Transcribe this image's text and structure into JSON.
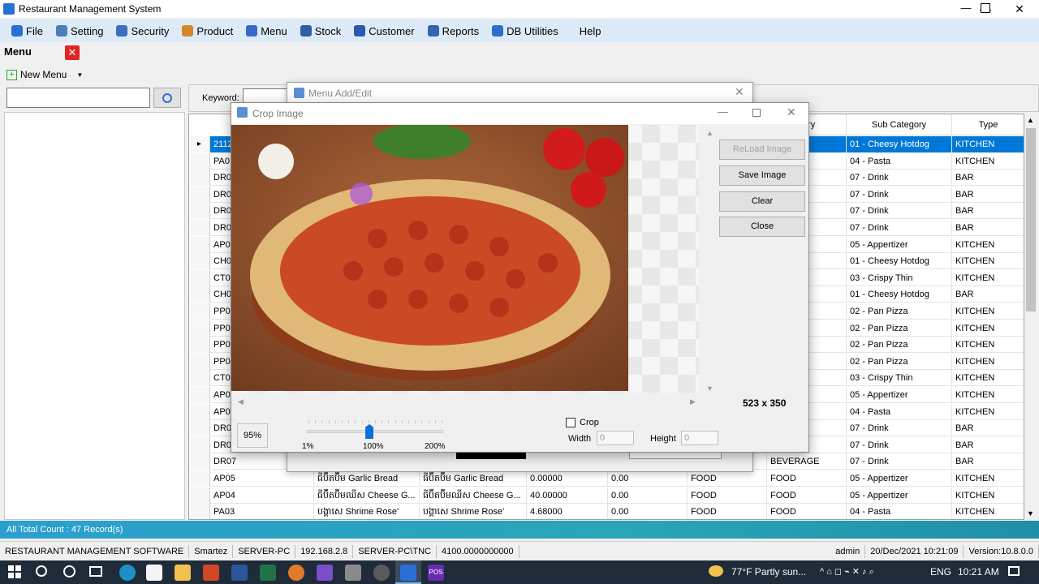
{
  "window": {
    "title": "Restaurant Management System"
  },
  "menubar": [
    {
      "label": "File",
      "color": "#2a6fd6"
    },
    {
      "label": "Setting",
      "color": "#4a7fb8"
    },
    {
      "label": "Security",
      "color": "#3c6fc0"
    },
    {
      "label": "Product",
      "color": "#d08a2a"
    },
    {
      "label": "Menu",
      "color": "#3a68c8"
    },
    {
      "label": "Stock",
      "color": "#2f5fa8"
    },
    {
      "label": "Customer",
      "color": "#2b58b0"
    },
    {
      "label": "Reports",
      "color": "#3266b5"
    },
    {
      "label": "DB Utilities",
      "color": "#2d6dcc"
    },
    {
      "label": "Help",
      "color": ""
    }
  ],
  "left": {
    "title": "Menu",
    "close_label": "✕",
    "new_menu_label": "New Menu"
  },
  "keyword_label": "Keyword:",
  "grid": {
    "headers": {
      "category": "ory",
      "subcategory": "Sub Category",
      "type": "Type"
    },
    "rows": [
      {
        "code": "2112",
        "name": "",
        "name2": "",
        "price": "",
        "disc": "",
        "group": "",
        "category": "",
        "sub": "01 - Cheesy Hotdog",
        "type": "KITCHEN",
        "selected": true
      },
      {
        "code": "PA0",
        "name": "",
        "name2": "",
        "price": "",
        "disc": "",
        "group": "",
        "category": "",
        "sub": "04 - Pasta",
        "type": "KITCHEN"
      },
      {
        "code": "DR0",
        "name": "",
        "name2": "",
        "price": "",
        "disc": "",
        "group": "",
        "category": "E",
        "sub": "07 - Drink",
        "type": "BAR"
      },
      {
        "code": "DR0",
        "name": "",
        "name2": "",
        "price": "",
        "disc": "",
        "group": "",
        "category": "E",
        "sub": "07 - Drink",
        "type": "BAR"
      },
      {
        "code": "DR0",
        "name": "",
        "name2": "",
        "price": "",
        "disc": "",
        "group": "",
        "category": "E",
        "sub": "07 - Drink",
        "type": "BAR"
      },
      {
        "code": "DR0",
        "name": "",
        "name2": "",
        "price": "",
        "disc": "",
        "group": "",
        "category": "E",
        "sub": "07 - Drink",
        "type": "BAR"
      },
      {
        "code": "AP0",
        "name": "",
        "name2": "",
        "price": "",
        "disc": "",
        "group": "",
        "category": "",
        "sub": "05 - Appertizer",
        "type": "KITCHEN"
      },
      {
        "code": "CH0",
        "name": "",
        "name2": "",
        "price": "",
        "disc": "",
        "group": "",
        "category": "",
        "sub": "01 - Cheesy Hotdog",
        "type": "KITCHEN"
      },
      {
        "code": "CT0",
        "name": "",
        "name2": "",
        "price": "",
        "disc": "",
        "group": "",
        "category": "",
        "sub": "03 - Crispy Thin",
        "type": "KITCHEN"
      },
      {
        "code": "CH0",
        "name": "",
        "name2": "",
        "price": "",
        "disc": "",
        "group": "",
        "category": "",
        "sub": "01 - Cheesy Hotdog",
        "type": "BAR"
      },
      {
        "code": "PP0",
        "name": "",
        "name2": "",
        "price": "",
        "disc": "",
        "group": "",
        "category": "",
        "sub": "02 - Pan Pizza",
        "type": "KITCHEN"
      },
      {
        "code": "PP0",
        "name": "",
        "name2": "",
        "price": "",
        "disc": "",
        "group": "",
        "category": "",
        "sub": "02 - Pan Pizza",
        "type": "KITCHEN"
      },
      {
        "code": "PP0",
        "name": "",
        "name2": "",
        "price": "",
        "disc": "",
        "group": "",
        "category": "",
        "sub": "02 - Pan Pizza",
        "type": "KITCHEN"
      },
      {
        "code": "PP0",
        "name": "",
        "name2": "",
        "price": "",
        "disc": "",
        "group": "",
        "category": "",
        "sub": "02 - Pan Pizza",
        "type": "KITCHEN"
      },
      {
        "code": "CT0",
        "name": "",
        "name2": "",
        "price": "",
        "disc": "",
        "group": "",
        "category": "",
        "sub": "03 - Crispy Thin",
        "type": "KITCHEN"
      },
      {
        "code": "AP0",
        "name": "",
        "name2": "",
        "price": "",
        "disc": "",
        "group": "",
        "category": "",
        "sub": "05 - Appertizer",
        "type": "KITCHEN"
      },
      {
        "code": "AP0",
        "name": "",
        "name2": "",
        "price": "",
        "disc": "",
        "group": "",
        "category": "",
        "sub": "04 - Pasta",
        "type": "KITCHEN"
      },
      {
        "code": "DR0",
        "name": "",
        "name2": "",
        "price": "",
        "disc": "",
        "group": "",
        "category": "E",
        "sub": "07 - Drink",
        "type": "BAR"
      },
      {
        "code": "DR0",
        "name": "",
        "name2": "",
        "price": "",
        "disc": "",
        "group": "",
        "category": "E",
        "sub": "07 - Drink",
        "type": "BAR"
      },
      {
        "code": "DR07",
        "name": "",
        "name2": "",
        "price": "",
        "disc": "",
        "group": "",
        "category": "BEVERAGE",
        "sub": "07 - Drink",
        "type": "BAR"
      },
      {
        "code": "AP05",
        "name": "ធីប៊ីតប៊ីម Garlic Bread",
        "name2": "ធីប៊ីតប៊ីម Garlic Bread",
        "price": "0.00000",
        "disc": "0.00",
        "group": "FOOD",
        "category": "FOOD",
        "sub": "05 - Appertizer",
        "type": "KITCHEN"
      },
      {
        "code": "AP04",
        "name": "ធីប៊ីតប៊ីមឈីស Cheese G...",
        "name2": "ធីប៊ីតប៊ីមឈីស Cheese G...",
        "price": "40.00000",
        "disc": "0.00",
        "group": "FOOD",
        "category": "FOOD",
        "sub": "05 - Appertizer",
        "type": "KITCHEN"
      },
      {
        "code": "PA03",
        "name": "បង្គាសេ Shrime Rose'",
        "name2": "បង្គាសេ Shrime Rose'",
        "price": "4.68000",
        "disc": "0.00",
        "group": "FOOD",
        "category": "FOOD",
        "sub": "04 - Pasta",
        "type": "KITCHEN"
      }
    ]
  },
  "status_strip": "All  Total Count : 47 Record(s)",
  "statusbar": [
    "RESTAURANT MANAGEMENT SOFTWARE",
    "Smartez",
    "SERVER-PC",
    "192.168.2.8",
    "SERVER-PC\\TNC",
    "4100.0000000000"
  ],
  "statusbar_right": [
    "admin",
    "20/Dec/2021 10:21:09",
    "Version:10.8.0.0"
  ],
  "addedit": {
    "title": "Menu Add/Edit"
  },
  "crop": {
    "title": "Crop Image",
    "buttons": [
      "ReLoad Image",
      "Save Image",
      "Clear",
      "Close"
    ],
    "image_size": "523 x 350",
    "zoom": "95%",
    "zoom_fraction": 0.47,
    "scale_min": "1%",
    "scale_mid": "100%",
    "scale_max": "200%",
    "crop_label": "Crop",
    "width_label": "Width",
    "width_value": "0",
    "height_label": "Height",
    "height_value": "0"
  },
  "taskbar": {
    "weather": "77°F  Partly sun...",
    "lang": "ENG",
    "time": "10:21 AM"
  }
}
